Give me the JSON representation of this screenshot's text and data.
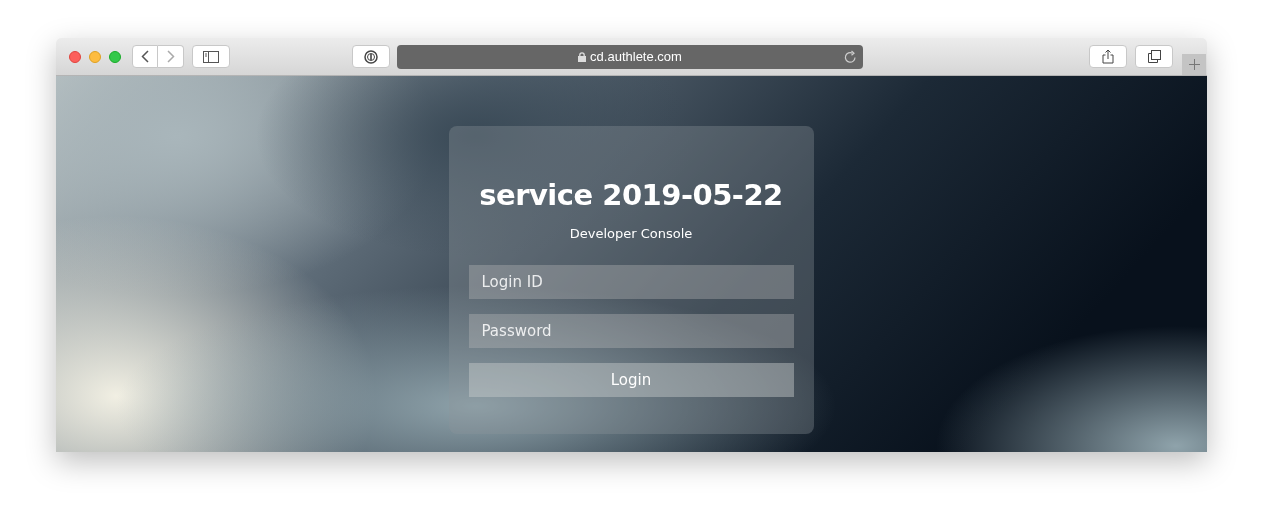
{
  "browser": {
    "url": "cd.authlete.com"
  },
  "login": {
    "title": "service 2019-05-22",
    "subtitle": "Developer Console",
    "fields": [
      {
        "placeholder": "Login ID"
      },
      {
        "placeholder": "Password"
      }
    ],
    "button": "Login"
  }
}
